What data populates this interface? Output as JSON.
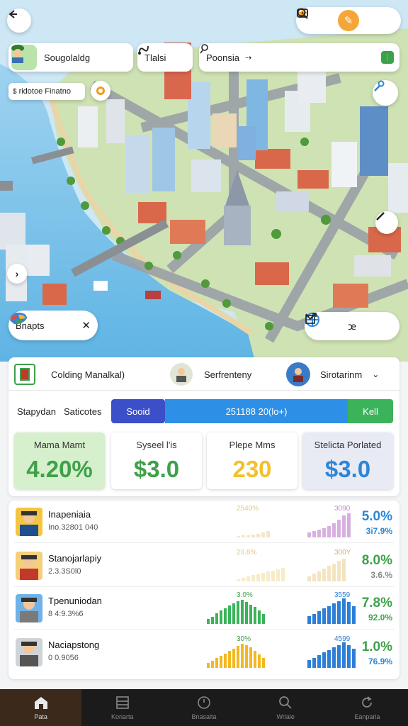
{
  "top_bar": {
    "user_name": "Sougolaldg",
    "search_label": "Tlalsi",
    "location_label": "Poonsia",
    "secondary_label": "ridotoe Finatno"
  },
  "map_chip": {
    "label": "Bnapts"
  },
  "panel": {
    "header": {
      "item1": "Colding Manalkal)",
      "item2": "Serfrenteny",
      "item3": "Sirotarinm"
    },
    "tabs": {
      "tab1": "Stapydan",
      "tab2": "Saticotes",
      "seg_left": "Sooid",
      "seg_mid": "251188 20(lo+)",
      "seg_right": "Kell"
    },
    "stats": [
      {
        "label": "Mama Mamt",
        "value": "4.20%",
        "bg": "#d6efcc",
        "color": "#3ea14a"
      },
      {
        "label": "Syseel l'is",
        "value": "$3.0",
        "bg": "#ffffff",
        "color": "#3ea14a"
      },
      {
        "label": "Plepe Mms",
        "value": "230",
        "bg": "#ffffff",
        "color": "#f2c12e"
      },
      {
        "label": "Stelicta Porlated",
        "value": "$3.0",
        "bg": "#e8eaf4",
        "color": "#2d86d6"
      }
    ]
  },
  "rows": [
    {
      "name": "Inapeniaia",
      "sub": "Ino.32801 040",
      "top_left": "2540%",
      "top_right": "3090",
      "pct1": "5.0%",
      "pct2": "3i7.9%",
      "pct1_color": "#2d86d6",
      "pct2_color": "#2d86d6",
      "bars1_color": "#f3e6c9",
      "bars2_color": "#d8b0e0",
      "avatar_bg": "#f5c542",
      "avatar_shirt": "#1f4e8c",
      "bars1": [
        0.05,
        0.08,
        0.1,
        0.12,
        0.15,
        0.2,
        0.25
      ],
      "bars2": [
        0.2,
        0.25,
        0.3,
        0.35,
        0.45,
        0.55,
        0.7,
        0.85,
        0.95
      ]
    },
    {
      "name": "Stanojarlapiy",
      "sub": "2.3.3S0l0",
      "top_left": "20.8%",
      "top_right": "300Y",
      "pct1": "8.0%",
      "pct2": "3.6.%",
      "pct1_color": "#3ea14a",
      "pct2_color": "#888888",
      "bars1_color": "#f6ecc8",
      "bars2_color": "#f3e4c2",
      "avatar_bg": "#f4d07a",
      "avatar_shirt": "#c0392b",
      "bars1": [
        0.1,
        0.15,
        0.2,
        0.25,
        0.3,
        0.35,
        0.4,
        0.45,
        0.5,
        0.55
      ],
      "bars2": [
        0.2,
        0.3,
        0.4,
        0.5,
        0.6,
        0.7,
        0.8,
        0.9
      ]
    },
    {
      "name": "Tpenuniodan",
      "sub": "8 4:9.3%6",
      "top_left": "3.0%",
      "top_right": "3559",
      "pct1": "7.8%",
      "pct2": "92.0%",
      "pct1_color": "#3ea14a",
      "pct2_color": "#3ea14a",
      "bars1_color": "#3bb35a",
      "bars2_color": "#2d7fd6",
      "avatar_bg": "#6fb2e8",
      "avatar_shirt": "#7a7a7a",
      "bars1": [
        0.2,
        0.3,
        0.45,
        0.55,
        0.65,
        0.75,
        0.85,
        0.95,
        1.0,
        0.9,
        0.8,
        0.7,
        0.55,
        0.4
      ],
      "bars2": [
        0.3,
        0.4,
        0.5,
        0.6,
        0.7,
        0.8,
        0.9,
        1.0,
        0.85,
        0.7
      ]
    },
    {
      "name": "Naciapstong",
      "sub": "0 0.9056",
      "top_left": "30%",
      "top_right": "4599",
      "pct1": "1.0%",
      "pct2": "76.9%",
      "pct1_color": "#3ea14a",
      "pct2_color": "#2d86d6",
      "bars1_color": "#f2b824",
      "bars2_color": "#2d7fd6",
      "avatar_bg": "#cfd4d8",
      "avatar_shirt": "#555555",
      "bars1": [
        0.2,
        0.3,
        0.4,
        0.5,
        0.6,
        0.7,
        0.8,
        0.9,
        1.0,
        0.95,
        0.85,
        0.7,
        0.55,
        0.4
      ],
      "bars2": [
        0.3,
        0.4,
        0.5,
        0.6,
        0.7,
        0.8,
        0.9,
        1.0,
        0.9,
        0.75
      ]
    }
  ],
  "nav": [
    {
      "label": "Pata",
      "icon": "home-icon",
      "active": true
    },
    {
      "label": "Koriarta",
      "icon": "list-icon",
      "active": false
    },
    {
      "label": "Bnasalta",
      "icon": "clock-icon",
      "active": false
    },
    {
      "label": "Wrlale",
      "icon": "search-icon",
      "active": false
    },
    {
      "label": "Eanparia",
      "icon": "refresh-icon",
      "active": false
    }
  ]
}
